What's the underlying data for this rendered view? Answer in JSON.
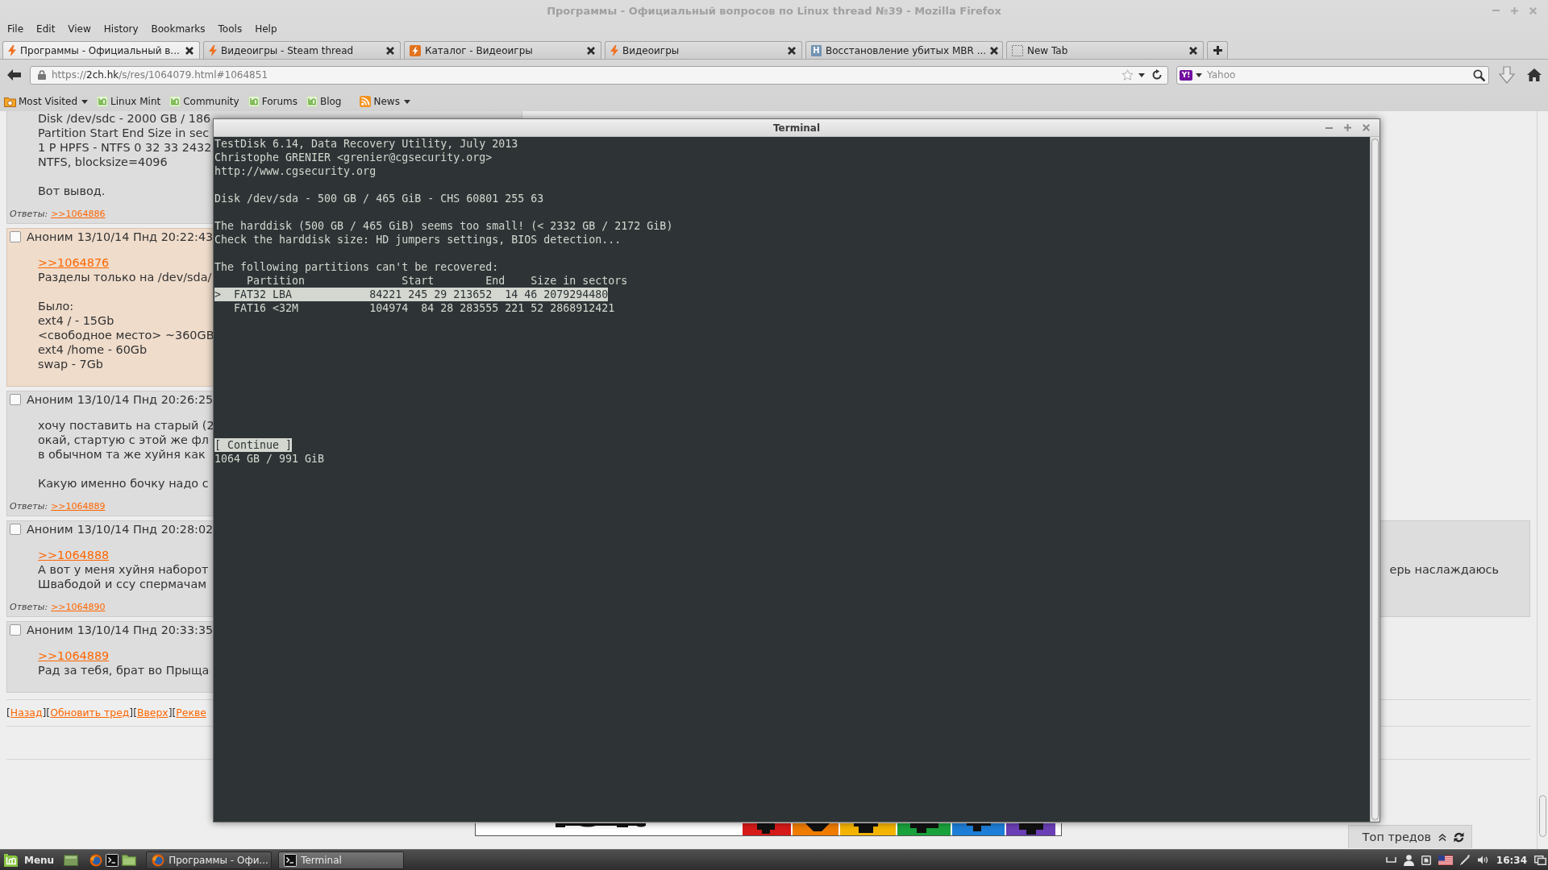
{
  "window": {
    "title": "Программы - Официальный вопросов по Linux thread №39 - Mozilla Firefox"
  },
  "menu": [
    "File",
    "Edit",
    "View",
    "History",
    "Bookmarks",
    "Tools",
    "Help"
  ],
  "tabs": [
    {
      "label": "Программы - Официальный в...",
      "kind": "bolt",
      "selected": true
    },
    {
      "label": "Видеоигры - Steam thread",
      "kind": "bolt",
      "selected": false
    },
    {
      "label": "Каталог - Видеоигры",
      "kind": "tile",
      "selected": false
    },
    {
      "label": "Видеоигры",
      "kind": "bolt",
      "selected": false
    },
    {
      "label": "Восстановление убитых MBR ...",
      "kind": "letter",
      "icon_text": "H",
      "selected": false
    },
    {
      "label": "New Tab",
      "kind": "blank",
      "selected": false
    }
  ],
  "navigation": {
    "url": {
      "scheme": "https://",
      "host": "2ch.hk",
      "path": "/s/res/1064079.html#1064851"
    },
    "search": {
      "engine_logo": "Y!",
      "placeholder": "Yahoo"
    }
  },
  "bookmarks": [
    {
      "label": "Most Visited",
      "kind": "smart-folder",
      "has_menu": true
    },
    {
      "label": "Linux Mint",
      "kind": "mint",
      "has_menu": false
    },
    {
      "label": "Community",
      "kind": "mint",
      "has_menu": false
    },
    {
      "label": "Forums",
      "kind": "mint",
      "has_menu": false
    },
    {
      "label": "Blog",
      "kind": "mint",
      "has_menu": false
    },
    {
      "label": "News",
      "kind": "feed",
      "has_menu": true
    }
  ],
  "page": {
    "posts": [
      {
        "highlighted": false,
        "body": [
          [
            {
              "kind": "text",
              "text": "Disk /dev/sdc - 2000 GB / 186"
            },
            {
              "kind": "text",
              "text": "Partition Start End Size in sec"
            },
            {
              "kind": "text",
              "text": "1 P HPFS - NTFS 0 32 33 2432"
            },
            {
              "kind": "text",
              "text": "NTFS, blocksize=4096"
            }
          ],
          [
            {
              "kind": "text",
              "text": "Вот вывод."
            }
          ]
        ],
        "replies": {
          "label": "Ответы:",
          "links": [
            ">>1064886"
          ]
        }
      },
      {
        "header": {
          "checked": false,
          "name": "Аноним",
          "date": "13/10/14 Пнд 20:22:43"
        },
        "highlighted": true,
        "body": [
          [
            {
              "kind": "link",
              "text": ">>1064876"
            },
            {
              "kind": "text",
              "text": "Разделы только на /dev/sda/"
            }
          ],
          [
            {
              "kind": "text",
              "text": "Было:"
            },
            {
              "kind": "text",
              "text": "ext4 / - 15Gb"
            },
            {
              "kind": "text",
              "text": "<свободное место> ~360GB"
            },
            {
              "kind": "text",
              "text": "ext4 /home - 60Gb"
            },
            {
              "kind": "text",
              "text": "swap - 7Gb"
            }
          ]
        ]
      },
      {
        "header": {
          "checked": false,
          "name": "Аноним",
          "date": "13/10/14 Пнд 20:26:25"
        },
        "highlighted": false,
        "body": [
          [
            {
              "kind": "text",
              "text": "хочу поставить на старый (2"
            },
            {
              "kind": "text",
              "text": "окай, стартую с этой же фл"
            },
            {
              "kind": "text",
              "text": "в обычном та же хуйня как"
            }
          ],
          [
            {
              "kind": "text",
              "text": "Какую именно бочку надо с"
            }
          ]
        ],
        "replies": {
          "label": "Ответы:",
          "links": [
            ">>1064889"
          ]
        }
      },
      {
        "header": {
          "checked": false,
          "name": "Аноним",
          "date": "13/10/14 Пнд 20:28:02"
        },
        "highlighted": false,
        "body": [
          [
            {
              "kind": "link",
              "text": ">>1064888"
            },
            {
              "kind": "text",
              "text": "А вот у меня хуйня наборот",
              "right_text": "ерь наслаждаюсь"
            },
            {
              "kind": "text",
              "text": "Швабодой и ссу спермачам"
            }
          ]
        ],
        "replies": {
          "label": "Ответы:",
          "links": [
            ">>1064890"
          ]
        }
      },
      {
        "header": {
          "checked": false,
          "name": "Аноним",
          "date": "13/10/14 Пнд 20:33:35"
        },
        "highlighted": false,
        "body": [
          [
            {
              "kind": "link",
              "text": ">>1064889"
            },
            {
              "kind": "text",
              "text": "Рад за тебя, брат во Прыща"
            }
          ]
        ]
      }
    ],
    "thread_nav": [
      {
        "kind": "text",
        "text": "["
      },
      {
        "kind": "link",
        "text": "Назад"
      },
      {
        "kind": "text",
        "text": "]["
      },
      {
        "kind": "link",
        "text": "Обновить тред"
      },
      {
        "kind": "text",
        "text": "]["
      },
      {
        "kind": "link",
        "text": "Вверх"
      },
      {
        "kind": "text",
        "text": "]["
      },
      {
        "kind": "link",
        "text": "Рекве"
      }
    ],
    "top_threads": {
      "label": "Топ тредов"
    }
  },
  "terminal": {
    "title": "Terminal",
    "blocks": [
      [
        "TestDisk 6.14, Data Recovery Utility, July 2013",
        "Christophe GRENIER <grenier@cgsecurity.org>",
        "http://www.cgsecurity.org"
      ],
      [
        "Disk /dev/sda - 500 GB / 465 GiB - CHS 60801 255 63"
      ],
      [
        "The harddisk (500 GB / 465 GiB) seems too small! (< 2332 GB / 2172 GiB)",
        "Check the harddisk size: HD jumpers settings, BIOS detection..."
      ],
      [
        "The following partitions can't be recovered:"
      ]
    ],
    "table_header": "     Partition               Start        End    Size in sectors",
    "partitions": [
      {
        "text": ">  FAT32 LBA            84221 245 29 213652  14 46 2079294480",
        "selected": true
      },
      {
        "text": "   FAT16 <32M           104974  84 28 283555 221 52 2868912421",
        "selected": false
      }
    ],
    "button": {
      "label": "[ Continue ]",
      "selected": true
    },
    "status": "1064 GB / 991 GiB"
  },
  "taskbar": {
    "menu_label": "Menu",
    "windows": [
      {
        "label": "Программы - Офи...",
        "kind": "browser",
        "selected": false
      },
      {
        "label": "Terminal",
        "kind": "terminal",
        "selected": true
      }
    ],
    "clock": "16:34"
  }
}
